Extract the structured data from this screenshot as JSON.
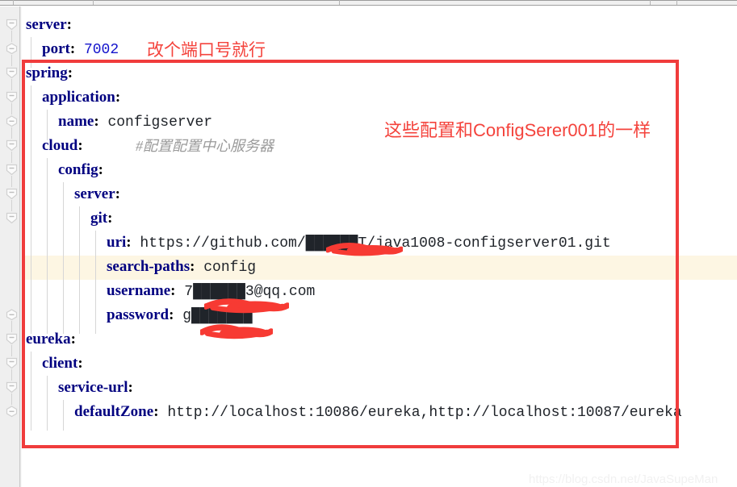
{
  "editor": {
    "file_type": "yaml",
    "gutter_fold_count": 13,
    "caret_line_index": 10
  },
  "code": {
    "lines": [
      {
        "indent": 0,
        "key": "server",
        "sep": ":",
        "value": "",
        "kind": "plain"
      },
      {
        "indent": 1,
        "key": "port",
        "sep": ":",
        "value": "7002",
        "kind": "number"
      },
      {
        "indent": 0,
        "key": "spring",
        "sep": ":",
        "value": "",
        "kind": "plain"
      },
      {
        "indent": 1,
        "key": "application",
        "sep": ":",
        "value": "",
        "kind": "plain"
      },
      {
        "indent": 2,
        "key": "name",
        "sep": ":",
        "value": "configserver",
        "kind": "plain"
      },
      {
        "indent": 1,
        "key": "cloud",
        "sep": ":",
        "value": "",
        "kind": "plain",
        "comment": "#配置配置中心服务器"
      },
      {
        "indent": 2,
        "key": "config",
        "sep": ":",
        "value": "",
        "kind": "plain"
      },
      {
        "indent": 3,
        "key": "server",
        "sep": ":",
        "value": "",
        "kind": "plain"
      },
      {
        "indent": 4,
        "key": "git",
        "sep": ":",
        "value": "",
        "kind": "plain"
      },
      {
        "indent": 5,
        "key": "uri",
        "sep": ":",
        "value": "https://github.com/██████T/java1008-configserver01.git",
        "kind": "plain",
        "redacted": true
      },
      {
        "indent": 5,
        "key": "search-paths",
        "sep": ":",
        "value": "config",
        "kind": "plain"
      },
      {
        "indent": 5,
        "key": "username",
        "sep": ":",
        "value": "7██████3@qq.com",
        "kind": "plain",
        "redacted": true
      },
      {
        "indent": 5,
        "key": "password",
        "sep": ":",
        "value": "g███████",
        "kind": "plain",
        "redacted": true
      },
      {
        "indent": 0,
        "key": "eureka",
        "sep": ":",
        "value": "",
        "kind": "plain"
      },
      {
        "indent": 1,
        "key": "client",
        "sep": ":",
        "value": "",
        "kind": "plain"
      },
      {
        "indent": 2,
        "key": "service-url",
        "sep": ":",
        "value": "",
        "kind": "plain"
      },
      {
        "indent": 3,
        "key": "defaultZone",
        "sep": ":",
        "value": "http://localhost:10086/eureka,http://localhost:10087/eureka",
        "kind": "plain"
      }
    ]
  },
  "annotations": [
    {
      "id": "port-note",
      "text": "改个端口号就行"
    },
    {
      "id": "config-note",
      "text": "这些配置和ConfigSerer001的一样"
    }
  ],
  "colors": {
    "annotation_red": "#f4433c",
    "redaction_red": "#f73a33",
    "key_navy": "#000080",
    "number_blue": "#1414cc",
    "comment_gray": "#9a9a9a",
    "caret_line_bg": "#fdf6e3",
    "gutter_bg": "#efefef"
  },
  "watermark": {
    "text": "https://blog.csdn.net/JavaSupeMan"
  }
}
